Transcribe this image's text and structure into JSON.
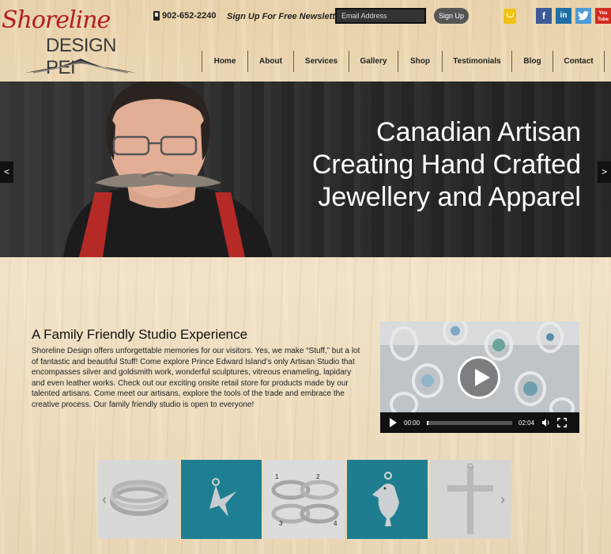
{
  "logo": {
    "script": "Shoreline",
    "design": "DESIGN PEI"
  },
  "header": {
    "phone": "902-652-2240",
    "signup_text": "Sign Up For Free Newsletter",
    "email_placeholder": "Email Address",
    "signup_button": "Sign Up"
  },
  "social": {
    "facebook": "f",
    "linkedin": "in",
    "twitter": "t",
    "youtube": "You Tube"
  },
  "nav": [
    {
      "label": "Home"
    },
    {
      "label": "About"
    },
    {
      "label": "Services"
    },
    {
      "label": "Gallery"
    },
    {
      "label": "Shop"
    },
    {
      "label": "Testimonials"
    },
    {
      "label": "Blog"
    },
    {
      "label": "Contact"
    }
  ],
  "hero": {
    "lines": [
      "Canadian Artisan",
      "Creating Hand Crafted",
      "Jewellery and Apparel"
    ],
    "prev": "<",
    "next": ">"
  },
  "about": {
    "title": "A Family Friendly Studio Experience",
    "body": "Shoreline Design offers unforgettable memories for our visitors. Yes, we make “Stuff,” but a lot of fantastic and beautiful Stuff! Come explore Prince Edward Island’s only Artisan Studio that encompasses silver and goldsmith work, wonderful sculptures, vitreous enameling, lapidary and even leather works. Check out our exciting onsite retail store for products made by our talented artisans.  Come meet our artisans, explore the tools of the trade and embrace the creative process. Our family friendly studio is open to everyone!"
  },
  "video": {
    "current_time": "00:00",
    "duration": "02:04",
    "progress": 0.0
  },
  "gallery": {
    "prev": "‹",
    "next": "›",
    "ring_numbers": [
      "1",
      "2",
      "3",
      "4"
    ]
  }
}
